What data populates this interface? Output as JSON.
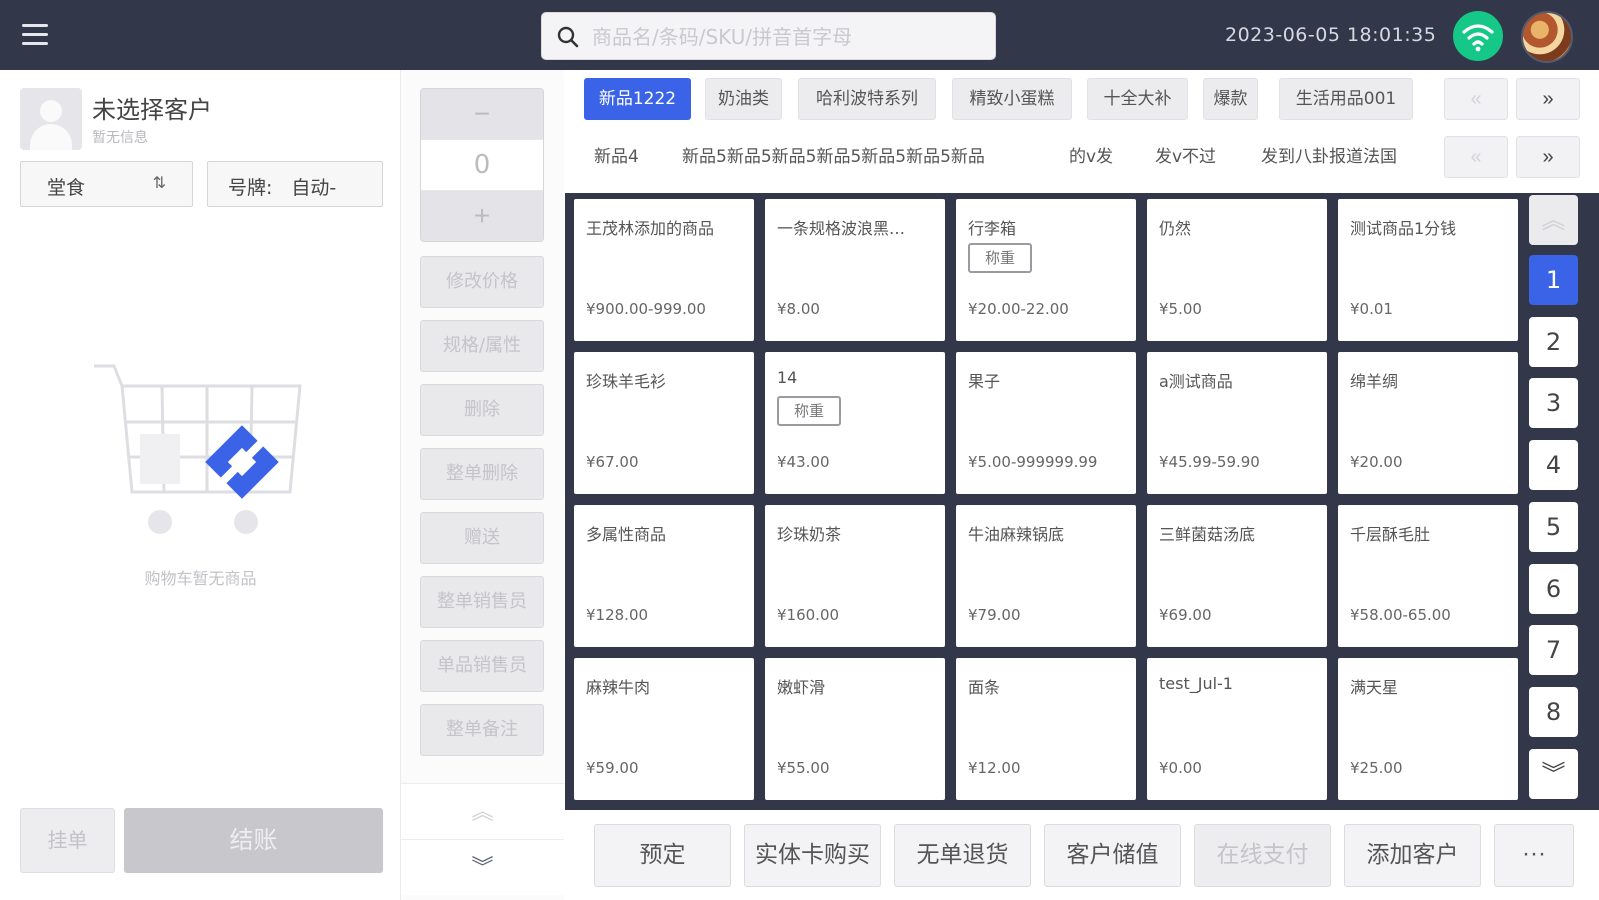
{
  "header": {
    "search_placeholder": "商品名/条码/SKU/拼音首字母",
    "datetime": "2023-06-05 18:01:35",
    "wifi_icon": "wifi-icon",
    "accent_color": "#3a63e8",
    "bar_color": "#33374a"
  },
  "customer": {
    "name": "未选择客户",
    "info": "暂无信息",
    "dine_mode": "堂食",
    "number_label": "号牌:　自动-"
  },
  "cart": {
    "empty_text": "购物车暂无商品"
  },
  "left_actions": {
    "hang_label": "挂单",
    "checkout_label": "结账"
  },
  "quantity": {
    "minus": "−",
    "value": "0",
    "plus": "+"
  },
  "actions": [
    {
      "label": "修改价格"
    },
    {
      "label": "规格/属性"
    },
    {
      "label": "删除"
    },
    {
      "label": "整单删除"
    },
    {
      "label": "赠送"
    },
    {
      "label": "整单销售员"
    },
    {
      "label": "单品销售员"
    },
    {
      "label": "整单备注"
    }
  ],
  "categories": [
    {
      "label": "新品1222",
      "active": true
    },
    {
      "label": "奶油类"
    },
    {
      "label": "哈利波特系列"
    },
    {
      "label": "精致小蛋糕"
    },
    {
      "label": "十全大补"
    },
    {
      "label": "爆款"
    },
    {
      "label": "生活用品001"
    }
  ],
  "subcategories": [
    {
      "label": "新品4"
    },
    {
      "label": "新品5新品5新品5新品5新品5新品5新品"
    },
    {
      "label": "的v发"
    },
    {
      "label": "发v不过"
    },
    {
      "label": "发到八卦报道法国"
    }
  ],
  "products": [
    {
      "name": "王茂林添加的商品",
      "price": "¥900.00-999.00"
    },
    {
      "name": "一条规格波浪黑…",
      "price": "¥8.00"
    },
    {
      "name": "行李箱",
      "tag": "称重",
      "price": "¥20.00-22.00"
    },
    {
      "name": "仍然",
      "price": "¥5.00"
    },
    {
      "name": "测试商品1分钱",
      "price": "¥0.01"
    },
    {
      "name": "珍珠羊毛衫",
      "price": "¥67.00"
    },
    {
      "name": "14",
      "tag": "称重",
      "price": "¥43.00"
    },
    {
      "name": "果子",
      "price": "¥5.00-999999.99"
    },
    {
      "name": "a测试商品",
      "price": "¥45.99-59.90"
    },
    {
      "name": "绵羊绸",
      "price": "¥20.00"
    },
    {
      "name": "多属性商品",
      "price": "¥128.00"
    },
    {
      "name": "珍珠奶茶",
      "price": "¥160.00"
    },
    {
      "name": "牛油麻辣锅底",
      "price": "¥79.00"
    },
    {
      "name": "三鲜菌菇汤底",
      "price": "¥69.00"
    },
    {
      "name": "千层酥毛肚",
      "price": "¥58.00-65.00"
    },
    {
      "name": "麻辣牛肉",
      "price": "¥59.00"
    },
    {
      "name": "嫩虾滑",
      "price": "¥55.00"
    },
    {
      "name": "面条",
      "price": "¥12.00"
    },
    {
      "name": "test_Jul-1",
      "price": "¥0.00"
    },
    {
      "name": "满天星",
      "price": "¥25.00"
    }
  ],
  "pages": [
    "1",
    "2",
    "3",
    "4",
    "5",
    "6",
    "7",
    "8"
  ],
  "current_page": "1",
  "bottom_actions": [
    {
      "label": "预定"
    },
    {
      "label": "实体卡购买"
    },
    {
      "label": "无单退货"
    },
    {
      "label": "客户储值"
    },
    {
      "label": "在线支付",
      "disabled": true
    },
    {
      "label": "添加客户"
    }
  ],
  "more_label": "···"
}
